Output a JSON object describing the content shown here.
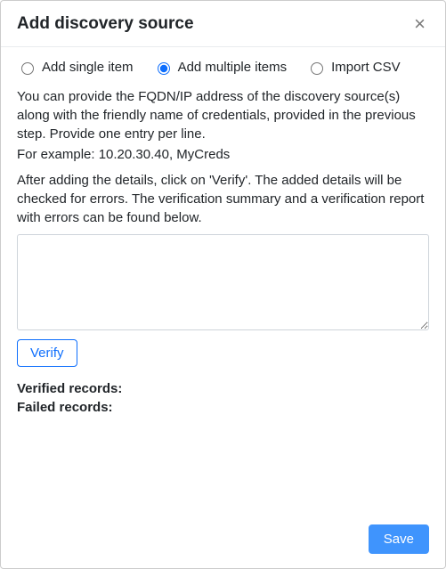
{
  "header": {
    "title": "Add discovery source",
    "close_glyph": "×"
  },
  "mode": {
    "single_label": "Add single item",
    "multiple_label": "Add multiple items",
    "import_label": "Import CSV",
    "selected": "multiple"
  },
  "instructions": {
    "line1": "You can provide the FQDN/IP address of the discovery source(s) along with the friendly name of credentials, provided in the previous step. Provide one entry per line.",
    "line2": "For example: 10.20.30.40, MyCreds"
  },
  "after_text": "After adding the details, click on 'Verify'. The added details will be checked for errors. The verification summary and a verification report with errors can be found below.",
  "entry_value": "",
  "verify_label": "Verify",
  "status": {
    "verified_label": "Verified records:",
    "verified_value": "",
    "failed_label": "Failed records:",
    "failed_value": ""
  },
  "footer": {
    "save_label": "Save"
  }
}
